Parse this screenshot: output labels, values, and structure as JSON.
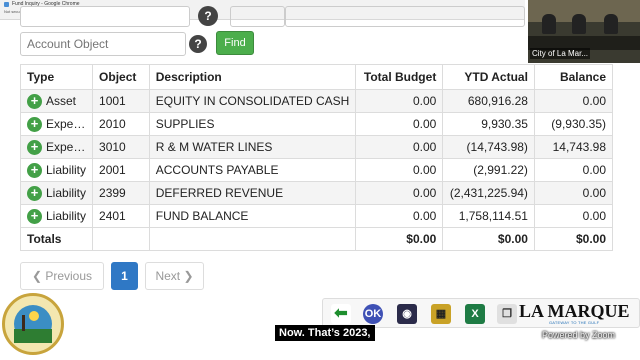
{
  "browser": {
    "tab_title": "Fund Inquiry - Google Chrome",
    "new_session": "Not secure",
    "url": "gov.lamarque.tx/inc/uv.php/ledg/glv/fnd.php"
  },
  "filters": {
    "account_object_placeholder": "Account Object",
    "help_label": "?",
    "find_label": "Find"
  },
  "table": {
    "columns": [
      "Type",
      "Object",
      "Description",
      "Total Budget",
      "YTD Actual",
      "Balance"
    ],
    "rows": [
      {
        "type": "Asset",
        "object": "1001",
        "description": "EQUITY IN CONSOLIDATED CASH",
        "total_budget": "0.00",
        "ytd_actual": "680,916.28",
        "balance": "0.00"
      },
      {
        "type": "Expe…",
        "object": "2010",
        "description": "SUPPLIES",
        "total_budget": "0.00",
        "ytd_actual": "9,930.35",
        "balance": "(9,930.35)"
      },
      {
        "type": "Expe…",
        "object": "3010",
        "description": "R & M WATER LINES",
        "total_budget": "0.00",
        "ytd_actual": "(14,743.98)",
        "balance": "14,743.98"
      },
      {
        "type": "Liability",
        "object": "2001",
        "description": "ACCOUNTS PAYABLE",
        "total_budget": "0.00",
        "ytd_actual": "(2,991.22)",
        "balance": "0.00"
      },
      {
        "type": "Liability",
        "object": "2399",
        "description": "DEFERRED REVENUE",
        "total_budget": "0.00",
        "ytd_actual": "(2,431,225.94)",
        "balance": "0.00"
      },
      {
        "type": "Liability",
        "object": "2401",
        "description": "FUND BALANCE",
        "total_budget": "0.00",
        "ytd_actual": "1,758,114.51",
        "balance": "0.00"
      }
    ],
    "totals": {
      "label": "Totals",
      "total_budget": "$0.00",
      "ytd_actual": "$0.00",
      "balance": "$0.00"
    }
  },
  "pagination": {
    "previous_label": "❮ Previous",
    "current_page": "1",
    "next_label": "Next ❯"
  },
  "video_tile": {
    "participant_name": "City of La Mar..."
  },
  "toolbar": {
    "icons": [
      "back-arrow-icon",
      "ok-icon",
      "camera-icon",
      "calculator-icon",
      "excel-icon",
      "copy-icon"
    ],
    "ok_label": "OK",
    "brand_text": "LA MARQUE",
    "brand_tagline": "GATEWAY TO THE GULF"
  },
  "caption": {
    "text": "Now. That’s 2023,"
  },
  "zoom": {
    "powered_by": "Powered by Zoom"
  },
  "colors": {
    "find_button": "#4cae4c",
    "current_page": "#2f78c5",
    "plus_icon": "#43a047",
    "row_stripe": "#f4f4f4"
  }
}
